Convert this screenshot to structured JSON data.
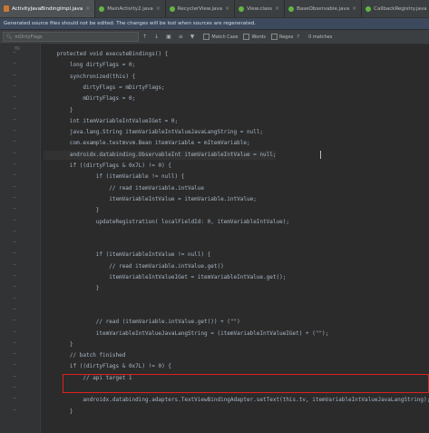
{
  "tabs": [
    {
      "label": "ActivityJavaBindingImpl.java",
      "kind": "java",
      "active": true
    },
    {
      "label": "MainActivity2.java",
      "kind": "class",
      "active": false
    },
    {
      "label": "RecyclerView.java",
      "kind": "class",
      "active": false
    },
    {
      "label": "View.class",
      "kind": "class",
      "active": false
    },
    {
      "label": "BaseObservable.java",
      "kind": "class",
      "active": false
    },
    {
      "label": "CallbackRegistry.java",
      "kind": "class",
      "active": false
    }
  ],
  "banner": {
    "text": "Generated source files should not be edited. The changes will be lost when sources are regenerated."
  },
  "search": {
    "query": "mDirtyFlags",
    "match_case": "Match Case",
    "words": "Words",
    "regex": "Regex",
    "help": "?",
    "results": "0 matches"
  },
  "gutter_label": "MR",
  "code_lines": [
    "    protected void executeBindings() {",
    "        long dirtyFlags = 0;",
    "        synchronized(this) {",
    "            dirtyFlags = mDirtyFlags;",
    "            mDirtyFlags = 0;",
    "        }",
    "        int itemVariableIntValueIGet = 0;",
    "        java.lang.String itemVariableIntValueJavaLangString = null;",
    "        com.example.testmvvm.Bean itemVariable = mItemVariable;",
    "        androidx.databinding.ObservableInt itemVariableIntValue = null;",
    "        if ((dirtyFlags & 0x7L) != 0) {",
    "                if (itemVariable != null) {",
    "                    // read itemVariable.intValue",
    "                    itemVariableIntValue = itemVariable.intValue;",
    "                }",
    "                updateRegistration( localFieldId: 0, itemVariableIntValue);",
    "",
    "",
    "                if (itemVariableIntValue != null) {",
    "                    // read itemVariable.intValue.get()",
    "                    itemVariableIntValueIGet = itemVariableIntValue.get();",
    "                }",
    "",
    "",
    "                // read (itemVariable.intValue.get()) + (\"\")",
    "                itemVariableIntValueJavaLangString = (itemVariableIntValueIGet) + (\"\");",
    "        }",
    "        // batch finished",
    "        if ((dirtyFlags & 0x7L) != 0) {",
    "            // api target 1",
    "",
    "            androidx.databinding.adapters.TextViewBindingAdapter.setText(this.tv, itemVariableIntValueJavaLangString);",
    "        }"
  ]
}
